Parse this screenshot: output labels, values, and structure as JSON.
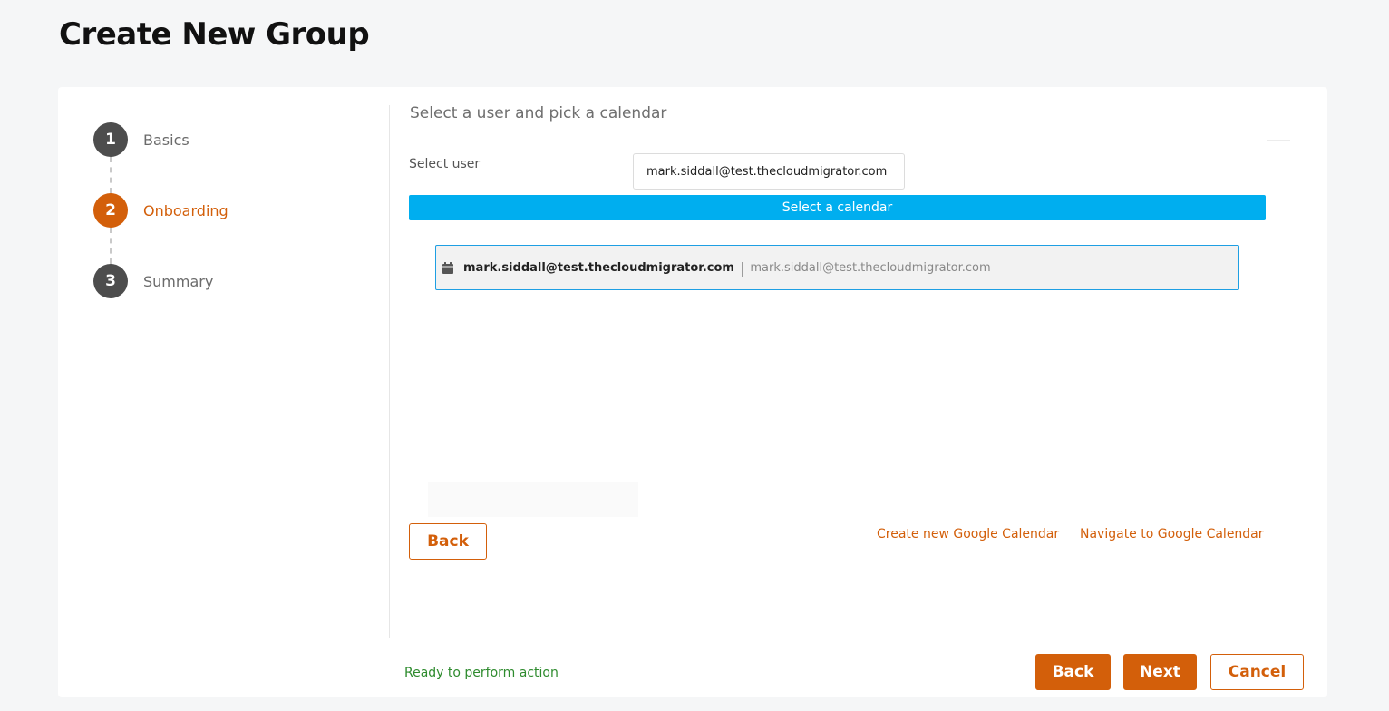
{
  "page": {
    "title": "Create New Group"
  },
  "stepper": {
    "steps": [
      {
        "number": "1",
        "label": "Basics",
        "state": "completed"
      },
      {
        "number": "2",
        "label": "Onboarding",
        "state": "active"
      },
      {
        "number": "3",
        "label": "Summary",
        "state": "pending"
      }
    ]
  },
  "main": {
    "section_title": "Select a user and pick a calendar",
    "user_label": "Select user",
    "user_value": "mark.siddall@test.thecloudmigrator.com",
    "calendar_bar_label": "Select a calendar",
    "calendars": [
      {
        "icon": "calendar-icon",
        "name": "mark.siddall@test.thecloudmigrator.com",
        "separator": "|",
        "id": "mark.siddall@test.thecloudmigrator.com"
      }
    ],
    "back_label": "Back",
    "create_link": "Create new Google Calendar",
    "navigate_link": "Navigate to Google Calendar"
  },
  "footer": {
    "status": "Ready to perform action",
    "back_label": "Back",
    "next_label": "Next",
    "cancel_label": "Cancel"
  },
  "colors": {
    "accent": "#d35f0a",
    "info_bar": "#00aeef",
    "selection_border": "#1e9fe3",
    "status_ok": "#2e8b2e",
    "step_done": "#4d4d4d"
  }
}
